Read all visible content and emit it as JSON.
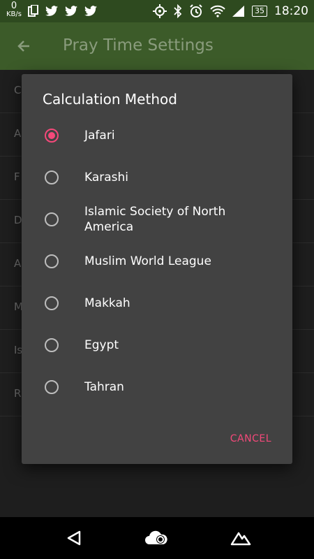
{
  "status_bar": {
    "net_speed": "0",
    "net_unit": "KB/s",
    "battery": "35",
    "time": "18:20"
  },
  "app_bar": {
    "title": "Pray Time Settings"
  },
  "background_list": {
    "items": [
      "C",
      "A",
      "F",
      "D",
      "A",
      "M",
      "Is",
      "R"
    ]
  },
  "dialog": {
    "title": "Calculation Method",
    "options": [
      {
        "label": "Jafari",
        "selected": true
      },
      {
        "label": "Karashi",
        "selected": false
      },
      {
        "label": "Islamic Society of North America",
        "selected": false
      },
      {
        "label": "Muslim World League",
        "selected": false
      },
      {
        "label": "Makkah",
        "selected": false
      },
      {
        "label": "Egypt",
        "selected": false
      },
      {
        "label": "Tahran",
        "selected": false
      }
    ],
    "cancel_label": "CANCEL"
  },
  "colors": {
    "accent": "#f4497a",
    "app_bar": "#3c5b29",
    "status_bar": "#2e4a1f",
    "dialog_bg": "#424242"
  },
  "icons": {
    "back": "arrow-left-icon",
    "nav_back": "triangle-back-icon",
    "nav_home": "cloud-home-icon",
    "nav_recent": "mountain-recent-icon"
  }
}
